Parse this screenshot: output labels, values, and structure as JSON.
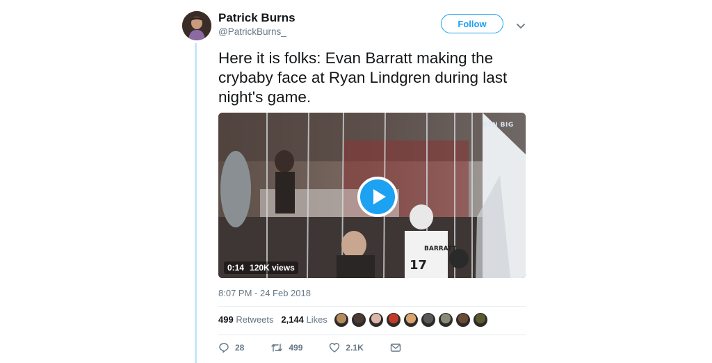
{
  "user": {
    "display_name": "Patrick Burns",
    "handle": "@PatrickBurns_",
    "avatar_icon": "avatar-photo"
  },
  "follow_label": "Follow",
  "tweet": {
    "text": "Here it is folks: Evan Barratt making the crybaby face at Ryan Lindgren during last night's game."
  },
  "video": {
    "duration": "0:14",
    "views": "120K views",
    "network_logo": "BTN BIG"
  },
  "timestamp": "8:07 PM - 24 Feb 2018",
  "stats": {
    "retweets_count": "499",
    "retweets_label": "Retweets",
    "likes_count": "2,144",
    "likes_label": "Likes"
  },
  "likers": [
    {
      "color": "#b58a5e"
    },
    {
      "color": "#4a3b35"
    },
    {
      "color": "#d9b8a8"
    },
    {
      "color": "#c23b2a"
    },
    {
      "color": "#d8a470"
    },
    {
      "color": "#585858"
    },
    {
      "color": "#8a8a78"
    },
    {
      "color": "#6b4a35"
    },
    {
      "color": "#5a5a30"
    }
  ],
  "actions": {
    "reply_count": "28",
    "retweet_count": "499",
    "like_count": "2.1K"
  },
  "colors": {
    "accent": "#1da1f2",
    "thread_line": "#c4e6f9",
    "secondary_text": "#657786"
  }
}
